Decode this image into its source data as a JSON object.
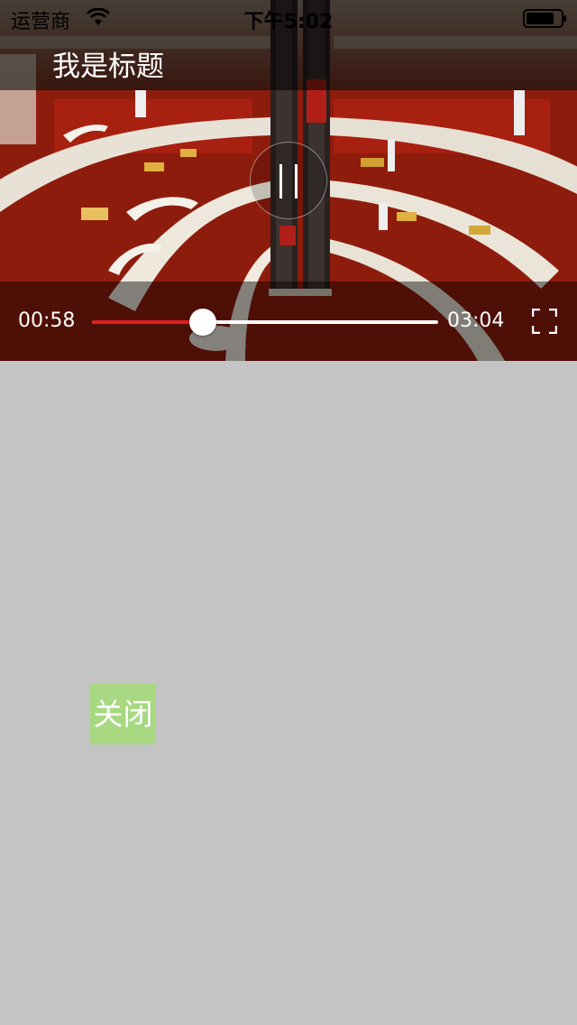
{
  "status_bar": {
    "carrier": "运营商",
    "time": "下午5:02",
    "wifi_icon": "wifi-icon",
    "battery_icon": "battery-icon"
  },
  "player": {
    "title": "我是标题",
    "state": "playing",
    "toggle_icon": "pause-icon",
    "current_time": "00:58",
    "total_time": "03:04",
    "progress": 0.32,
    "fullscreen_icon": "fullscreen-icon",
    "accent_color": "#e02020"
  },
  "page": {
    "close_label": "关闭",
    "close_color": "#a8d882",
    "background_color": "#c4c4c4"
  }
}
